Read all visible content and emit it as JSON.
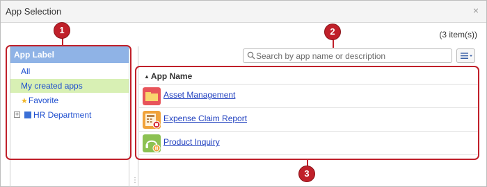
{
  "dialog": {
    "title": "App Selection",
    "close_glyph": "×",
    "item_count": "(3 item(s))"
  },
  "left_panel": {
    "header": "App Label",
    "items": [
      {
        "label": "All",
        "selected": false
      },
      {
        "label": "My created apps",
        "selected": true
      },
      {
        "label": "Favorite",
        "icon": "star-icon"
      },
      {
        "label": "HR Department",
        "icon": "folder-square-icon",
        "expand_glyph": "+"
      }
    ]
  },
  "search": {
    "placeholder": "Search by app name or description",
    "value": ""
  },
  "list": {
    "column_header": "App Name",
    "sort_glyph": "▲",
    "apps": [
      {
        "name": "Asset Management",
        "icon": "folder-app-icon",
        "color": "#e8545a"
      },
      {
        "name": "Expense Claim Report",
        "icon": "calculator-app-icon",
        "color": "#f0a23a"
      },
      {
        "name": "Product Inquiry",
        "icon": "headset-app-icon",
        "color": "#8cc152"
      }
    ]
  },
  "annotations": {
    "markers": [
      "1",
      "2",
      "3"
    ],
    "color": "#c0202a"
  }
}
